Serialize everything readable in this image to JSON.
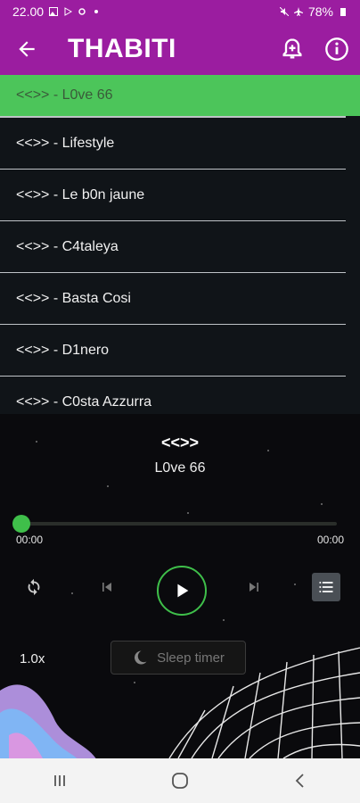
{
  "status_bar": {
    "time": "22.00",
    "battery": "78%"
  },
  "app_bar": {
    "title": "THABITI",
    "back_icon": "arrow-left-icon",
    "alarm_icon": "alarm-plus-icon",
    "info_icon": "info-icon"
  },
  "playlist": {
    "items": [
      "<<>> - L0ve 66",
      "<<>> - Lifestyle",
      "<<>> - Le b0n jaune",
      "<<>> - C4taleya",
      "<<>> - Basta Cosi",
      "<<>> - D1nero",
      "<<>> - C0sta Azzurra"
    ],
    "active_index": 0
  },
  "now_playing": {
    "artist": "<<>>",
    "title": "L0ve 66",
    "elapsed": "00:00",
    "duration": "00:00",
    "progress": 0,
    "speed": "1.0x",
    "sleep_timer": "Sleep timer"
  },
  "colors": {
    "accent_purple": "#9b1da0",
    "accent_green": "#3fbf4a"
  }
}
